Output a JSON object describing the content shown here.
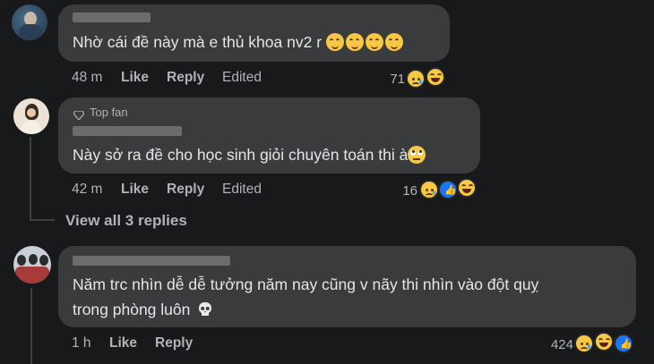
{
  "comments": [
    {
      "text": "Nhờ cái đề này mà e thủ khoa nv2 r",
      "time": "48 m",
      "like": "Like",
      "reply": "Reply",
      "edited": "Edited",
      "reactions_count": "71",
      "reaction_icons": [
        "sad-face",
        "laughing-face"
      ],
      "inline_emoji": [
        "smiling-hearts-face",
        "smiling-hearts-face",
        "smiling-hearts-face",
        "smiling-hearts-face"
      ]
    },
    {
      "badge": "Top fan",
      "text": "Này sở ra đề cho học sinh giỏi chuyên toán thi à",
      "time": "42 m",
      "like": "Like",
      "reply": "Reply",
      "edited": "Edited",
      "reactions_count": "16",
      "reaction_icons": [
        "sad-face",
        "like-thumb",
        "laughing-face"
      ],
      "inline_emoji": [
        "rolling-eyes-face"
      ]
    },
    {
      "text_line1": "Năm trc nhìn dễ dễ tưởng năm nay cũng v nãy thi nhìn vào đột quỵ",
      "text_line2": "trong phòng luôn",
      "time": "1 h",
      "like": "Like",
      "reply": "Reply",
      "reactions_count": "424",
      "reaction_icons": [
        "sad-face",
        "laughing-face",
        "like-thumb"
      ],
      "inline_emoji": [
        "skull"
      ]
    }
  ],
  "view_replies": "View all 3 replies",
  "colors": {
    "background": "#18191a",
    "bubble": "#3a3b3c",
    "text": "#e4e6eb",
    "meta": "#b0b3b8",
    "like_blue": "#1877f2",
    "emoji_yellow": "#f7c844"
  }
}
